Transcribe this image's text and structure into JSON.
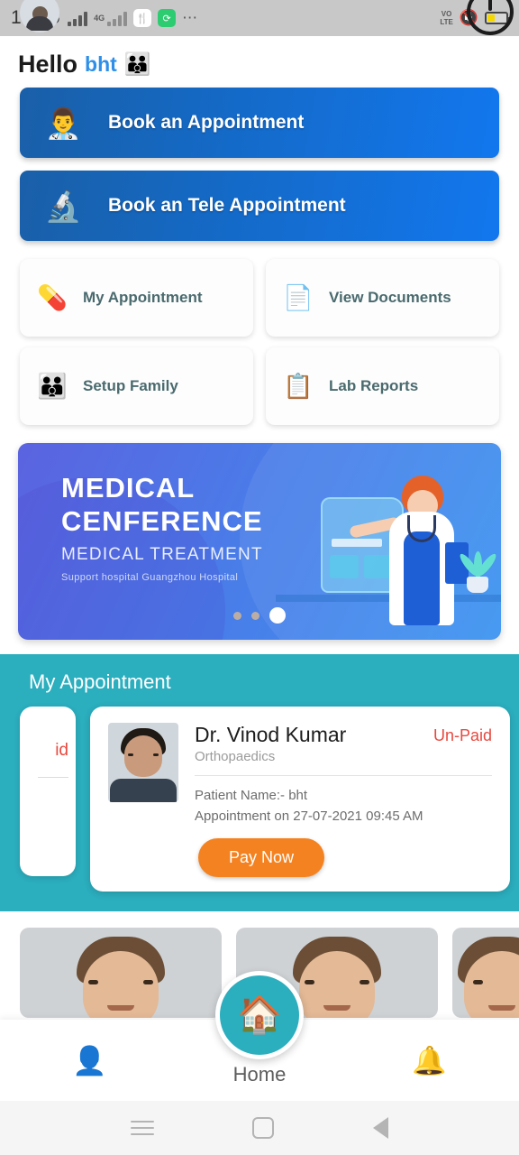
{
  "status_bar": {
    "time": "14:45",
    "network_label": "4G",
    "volte_line1": "VO",
    "volte_line2": "LTE",
    "icons": [
      "signal-bars-icon",
      "signal-bars-secondary-icon",
      "app-icon-yellow",
      "app-icon-green",
      "overflow-dots-icon",
      "volte-icon",
      "mute-icon",
      "battery-icon"
    ]
  },
  "greeting": {
    "hello": "Hello",
    "username": "bht",
    "emoji": "👪"
  },
  "primary_actions": [
    {
      "label": "Book an Appointment",
      "icon": "doctor-icon",
      "glyph": "👨‍⚕️"
    },
    {
      "label": "Book an Tele Appointment",
      "icon": "microscope-icon",
      "glyph": "🔬"
    }
  ],
  "quick_cards": [
    {
      "label": "My Appointment",
      "icon": "medicine-bottle-icon",
      "glyph": "💊"
    },
    {
      "label": "View Documents",
      "icon": "document-eye-icon",
      "glyph": "📄"
    },
    {
      "label": "Setup Family",
      "icon": "family-icon",
      "glyph": "👪"
    },
    {
      "label": "Lab Reports",
      "icon": "clipboard-icon",
      "glyph": "📋"
    }
  ],
  "banner": {
    "title_line1": "MEDICAL",
    "title_line2": "CENFERENCE",
    "subtitle": "MEDICAL TREATMENT",
    "caption": "Support hospital   Guangzhou Hospital",
    "dot_count": 3,
    "active_dot": 3
  },
  "appointments": {
    "section_title": "My Appointment",
    "previous_card_fragment": "id",
    "card": {
      "doctor_name": "Dr. Vinod Kumar",
      "specialty": "Orthopaedics",
      "payment_status": "Un-Paid",
      "patient_line": "Patient Name:- bht",
      "appointment_line": "Appointment on 27-07-2021 09:45 AM",
      "action_label": "Pay Now"
    }
  },
  "doctor_thumbnails": [
    {
      "name": "doctor-thumb-1"
    },
    {
      "name": "doctor-thumb-2"
    },
    {
      "name": "doctor-thumb-3"
    }
  ],
  "bottom_nav": {
    "profile_icon": "👤",
    "home_label": "Home",
    "home_icon": "🏠",
    "bell_icon": "🔔"
  },
  "android_nav": {
    "recents": "recents-icon",
    "home": "home-square-icon",
    "back": "back-triangle-icon"
  },
  "colors": {
    "teal": "#2baebe",
    "blue_dark": "#1a5fa8",
    "blue_light": "#1277ee",
    "orange": "#f58220",
    "red": "#e8493f",
    "card_label": "#4a6a6e",
    "username_blue": "#2f8fe8"
  }
}
